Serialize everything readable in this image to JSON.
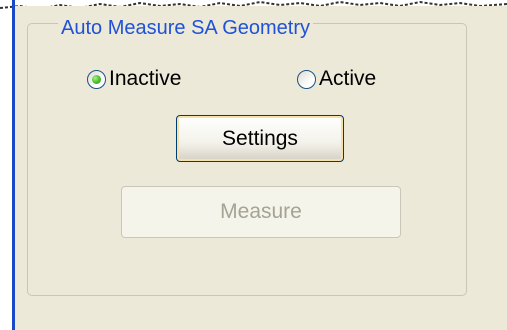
{
  "group": {
    "title": "Auto Measure SA Geometry"
  },
  "mode": {
    "options": [
      {
        "label": "Inactive",
        "selected": true
      },
      {
        "label": "Active",
        "selected": false
      }
    ]
  },
  "buttons": {
    "settings_label": "Settings",
    "measure_label": "Measure",
    "measure_enabled": false
  },
  "colors": {
    "group_title": "#1f52d6",
    "panel_background": "#ece9d8",
    "window_border": "#1a49c8",
    "disabled_text": "#a6a395"
  }
}
